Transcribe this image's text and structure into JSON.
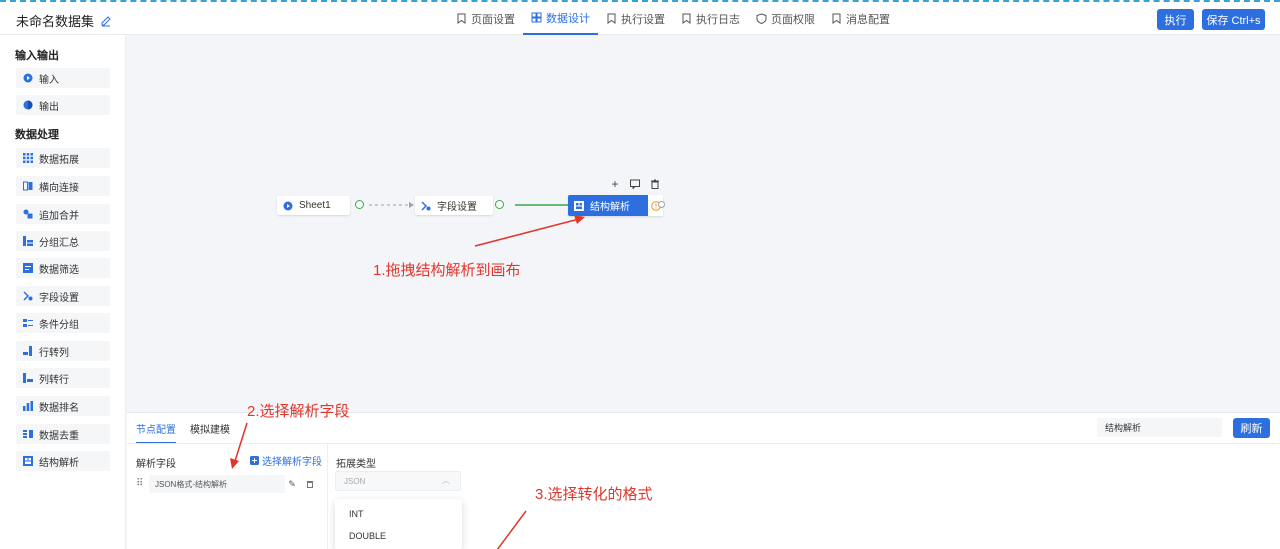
{
  "header": {
    "title": "未命名数据集",
    "tabs": [
      {
        "label": "页面设置"
      },
      {
        "label": "数据设计"
      },
      {
        "label": "执行设置"
      },
      {
        "label": "执行日志"
      },
      {
        "label": "页面权限"
      },
      {
        "label": "消息配置"
      }
    ],
    "active_tab": "数据设计",
    "run_label": "执行",
    "save_label": "保存 Ctrl+s"
  },
  "sidebar": {
    "group1": "输入输出",
    "io_items": [
      {
        "label": "输入"
      },
      {
        "label": "输出"
      }
    ],
    "group2": "数据处理",
    "proc_items": [
      {
        "label": "数据拓展"
      },
      {
        "label": "横向连接"
      },
      {
        "label": "追加合并"
      },
      {
        "label": "分组汇总"
      },
      {
        "label": "数据筛选"
      },
      {
        "label": "字段设置"
      },
      {
        "label": "条件分组"
      },
      {
        "label": "行转列"
      },
      {
        "label": "列转行"
      },
      {
        "label": "数据排名"
      },
      {
        "label": "数据去重"
      },
      {
        "label": "结构解析"
      }
    ]
  },
  "canvas": {
    "nodes": [
      {
        "label": "Sheet1"
      },
      {
        "label": "字段设置"
      },
      {
        "label": "结构解析"
      }
    ],
    "annotation1": "1.拖拽结构解析到画布"
  },
  "panel": {
    "tabs": [
      {
        "label": "节点配置"
      },
      {
        "label": "模拟建模"
      }
    ],
    "node_name": "结构解析",
    "refresh_label": "刷新",
    "parse_field_label": "解析字段",
    "select_field_label": "选择解析字段",
    "field_value": "JSON格式-结构解析",
    "expand_type_label": "拓展类型",
    "expand_type_value": "JSON",
    "options": [
      {
        "label": "INT"
      },
      {
        "label": "DOUBLE"
      }
    ],
    "annotation2": "2.选择解析字段",
    "annotation3": "3.选择转化的格式"
  },
  "colors": {
    "accent": "#2e6fe0",
    "annotation": "#e0362c",
    "link": "#3aa84a"
  }
}
